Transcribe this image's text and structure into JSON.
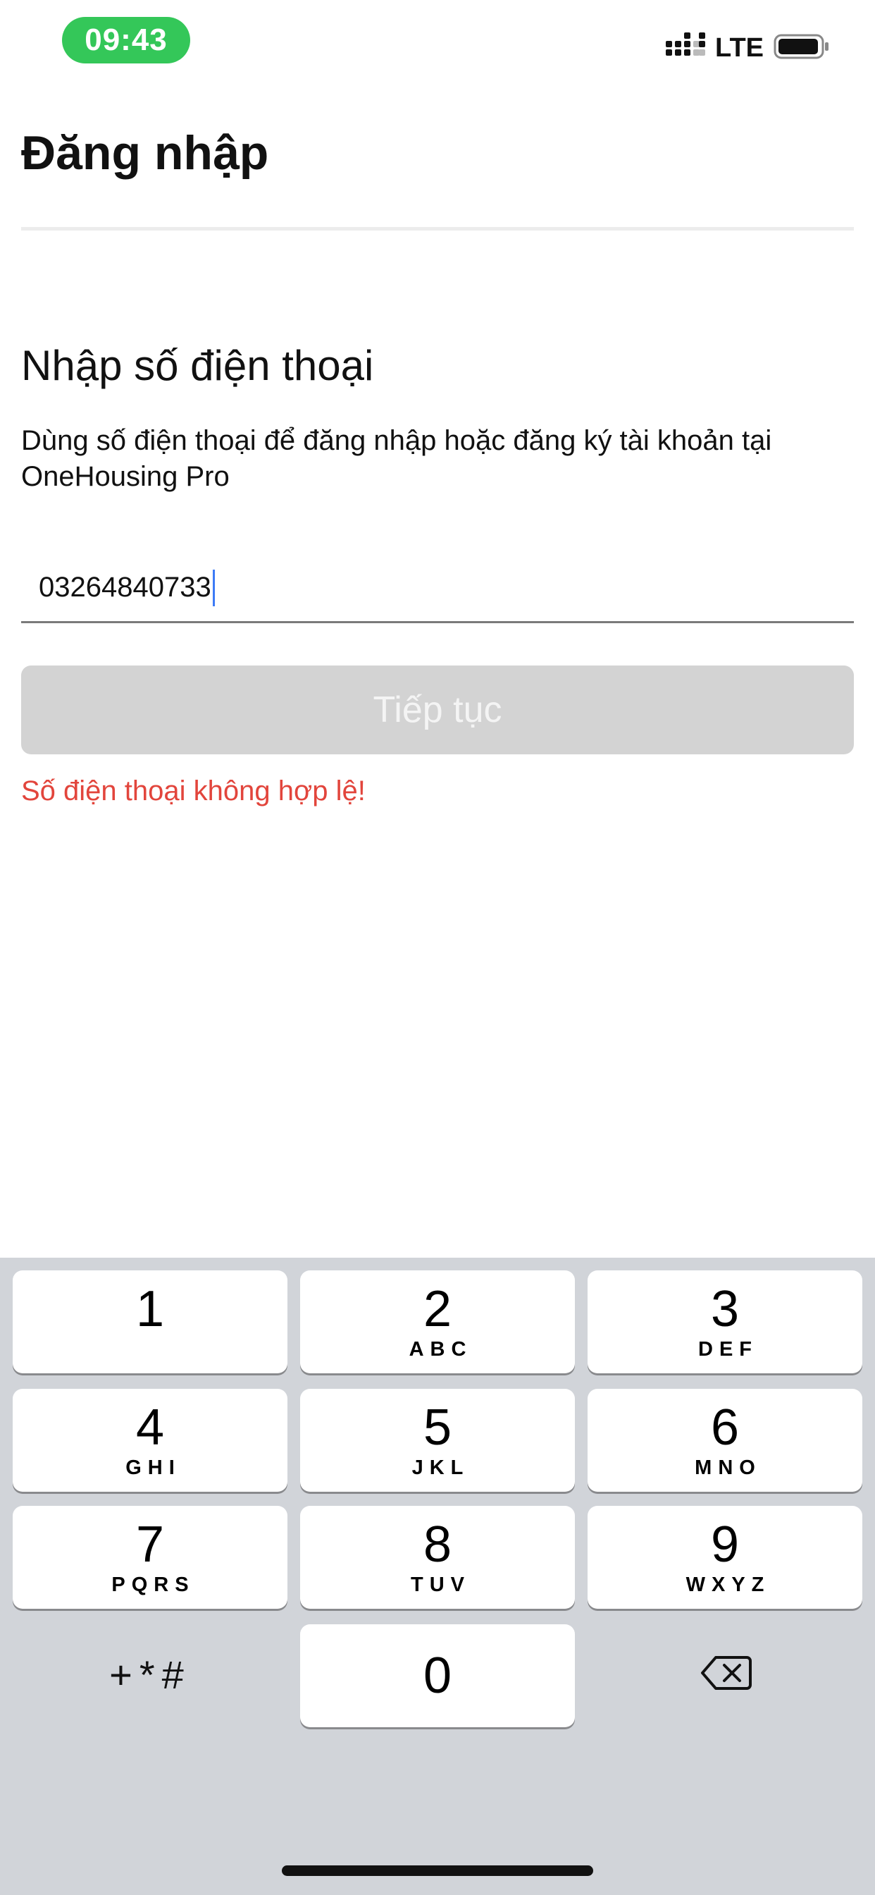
{
  "status_bar": {
    "time": "09:43",
    "network": "LTE",
    "icons": [
      "signal-icon",
      "battery-icon"
    ]
  },
  "header": {
    "title": "Đăng nhập"
  },
  "main": {
    "heading": "Nhập số điện thoại",
    "description": "Dùng số điện thoại để đăng nhập hoặc đăng ký tài khoản tại OneHousing Pro",
    "phone_value": "03264840733",
    "continue_label": "Tiếp tục",
    "error_message": "Số điện thoại không hợp lệ!"
  },
  "keypad": {
    "keys": [
      {
        "digit": "1",
        "letters": ""
      },
      {
        "digit": "2",
        "letters": "ABC"
      },
      {
        "digit": "3",
        "letters": "DEF"
      },
      {
        "digit": "4",
        "letters": "GHI"
      },
      {
        "digit": "5",
        "letters": "JKL"
      },
      {
        "digit": "6",
        "letters": "MNO"
      },
      {
        "digit": "7",
        "letters": "PQRS"
      },
      {
        "digit": "8",
        "letters": "TUV"
      },
      {
        "digit": "9",
        "letters": "WXYZ"
      },
      {
        "digit": "0",
        "letters": ""
      }
    ],
    "symbols_label": "+*#",
    "delete_icon": "backspace-icon"
  },
  "colors": {
    "time_pill": "#34c759",
    "error": "#e2453c",
    "button_disabled": "#d3d3d3",
    "keyboard_bg": "#d1d4d9",
    "caret": "#3d7bf6"
  }
}
